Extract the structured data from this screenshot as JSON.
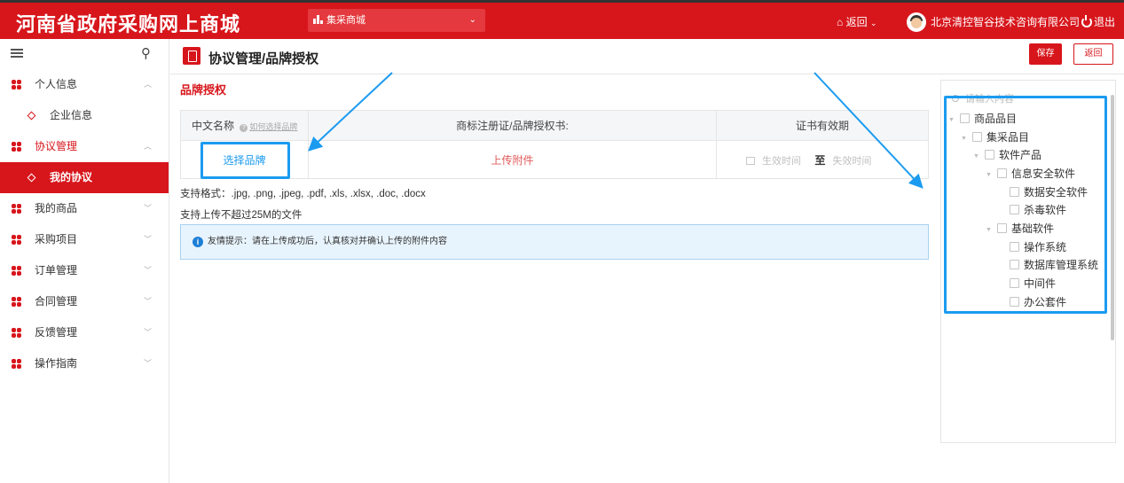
{
  "header": {
    "site_title": "河南省政府采购网上商城",
    "mall_select": "集采商城",
    "back_label": "返回",
    "company": "北京清控智谷技术咨询有限公司",
    "logout": "退出",
    "icons": [
      "bar-chart-icon",
      "home-icon",
      "chevron-down-icon",
      "avatar",
      "power-icon"
    ]
  },
  "sidebar": {
    "items": [
      {
        "label": "个人信息",
        "expanded": true
      },
      {
        "label": "企业信息",
        "sub": true
      },
      {
        "label": "协议管理",
        "expanded": true
      },
      {
        "label": "我的协议",
        "sub": true,
        "active": true
      },
      {
        "label": "我的商品"
      },
      {
        "label": "采购项目"
      },
      {
        "label": "订单管理"
      },
      {
        "label": "合同管理"
      },
      {
        "label": "反馈管理"
      },
      {
        "label": "操作指南"
      }
    ]
  },
  "page": {
    "title": "协议管理/品牌授权",
    "save_label": "保存",
    "back_label": "返回",
    "section_title": "品牌授权"
  },
  "table": {
    "col_name": "中文名称",
    "help_link": "如何选择品牌",
    "col_cert": "商标注册证/品牌授权书:",
    "col_valid": "证书有效期",
    "select_brand": "选择品牌",
    "upload": "上传附件",
    "start_ph": "生效时间",
    "to": "至",
    "end_ph": "失效时间"
  },
  "notes": {
    "formats": "支持格式：.jpg, .png, .jpeg, .pdf, .xls, .xlsx, .doc, .docx",
    "size": "支持上传不超过25M的文件",
    "tip": "友情提示：请在上传成功后，认真核对并确认上传的附件内容"
  },
  "tree": {
    "search_placeholder": "请输入内容",
    "nodes": [
      {
        "label": "商品品目",
        "level": 0,
        "toggle": true
      },
      {
        "label": "集采品目",
        "level": 1,
        "toggle": true
      },
      {
        "label": "软件产品",
        "level": 2,
        "toggle": true
      },
      {
        "label": "信息安全软件",
        "level": 3,
        "toggle": true
      },
      {
        "label": "数据安全软件",
        "level": 4,
        "toggle": false
      },
      {
        "label": "杀毒软件",
        "level": 4,
        "toggle": false
      },
      {
        "label": "基础软件",
        "level": 3,
        "toggle": true
      },
      {
        "label": "操作系统",
        "level": 4,
        "toggle": false
      },
      {
        "label": "数据库管理系统",
        "level": 4,
        "toggle": false
      },
      {
        "label": "中间件",
        "level": 4,
        "toggle": false
      },
      {
        "label": "办公套件",
        "level": 4,
        "toggle": false
      }
    ]
  },
  "colors": {
    "brand_red": "#d7161c",
    "highlight_blue": "#1b9bf0"
  }
}
